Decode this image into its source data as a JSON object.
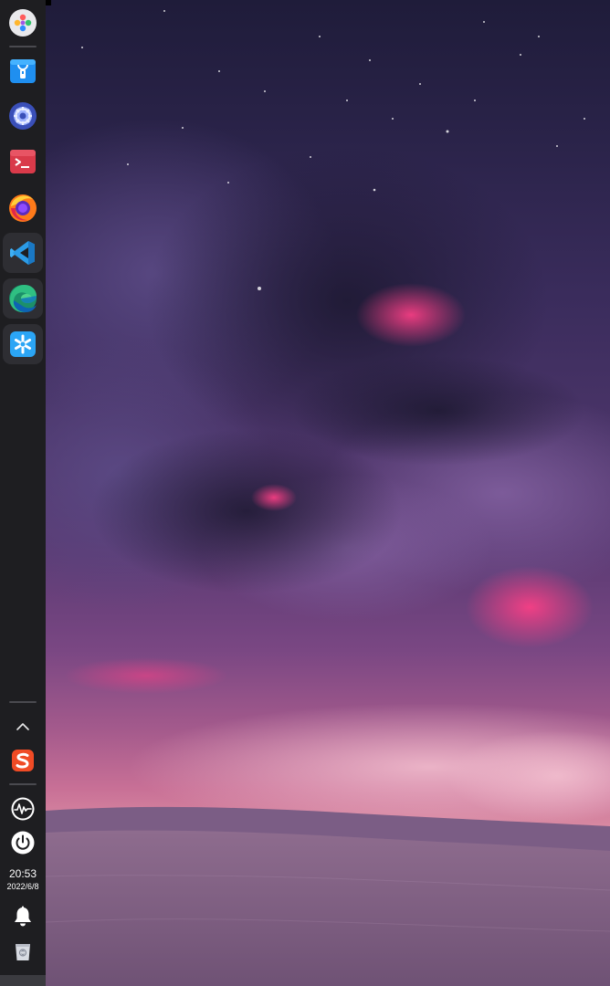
{
  "desktop": {
    "wallpaper": "night-desert-storm-wallpaper"
  },
  "dock": {
    "background_color": "#1e1e21",
    "apps": [
      {
        "icon": "launcher-icon",
        "active": false
      },
      {
        "icon": "app-store-icon",
        "active": false
      },
      {
        "icon": "settings-gear-icon",
        "active": false
      },
      {
        "icon": "terminal-icon",
        "active": false
      },
      {
        "icon": "firefox-icon",
        "active": false
      },
      {
        "icon": "vscode-icon",
        "active": true
      },
      {
        "icon": "edge-browser-icon",
        "active": true
      },
      {
        "icon": "screenshot-tool-icon",
        "active": true
      }
    ],
    "tray": {
      "expand_icon": "chevron-up-icon",
      "input_method_icon": "sogou-input-icon",
      "monitor_icon": "system-monitor-icon",
      "power_icon": "power-icon",
      "notifications_icon": "bell-icon",
      "trash_icon": "trash-icon"
    },
    "clock": {
      "time": "20:53",
      "date": "2022/6/8"
    }
  }
}
